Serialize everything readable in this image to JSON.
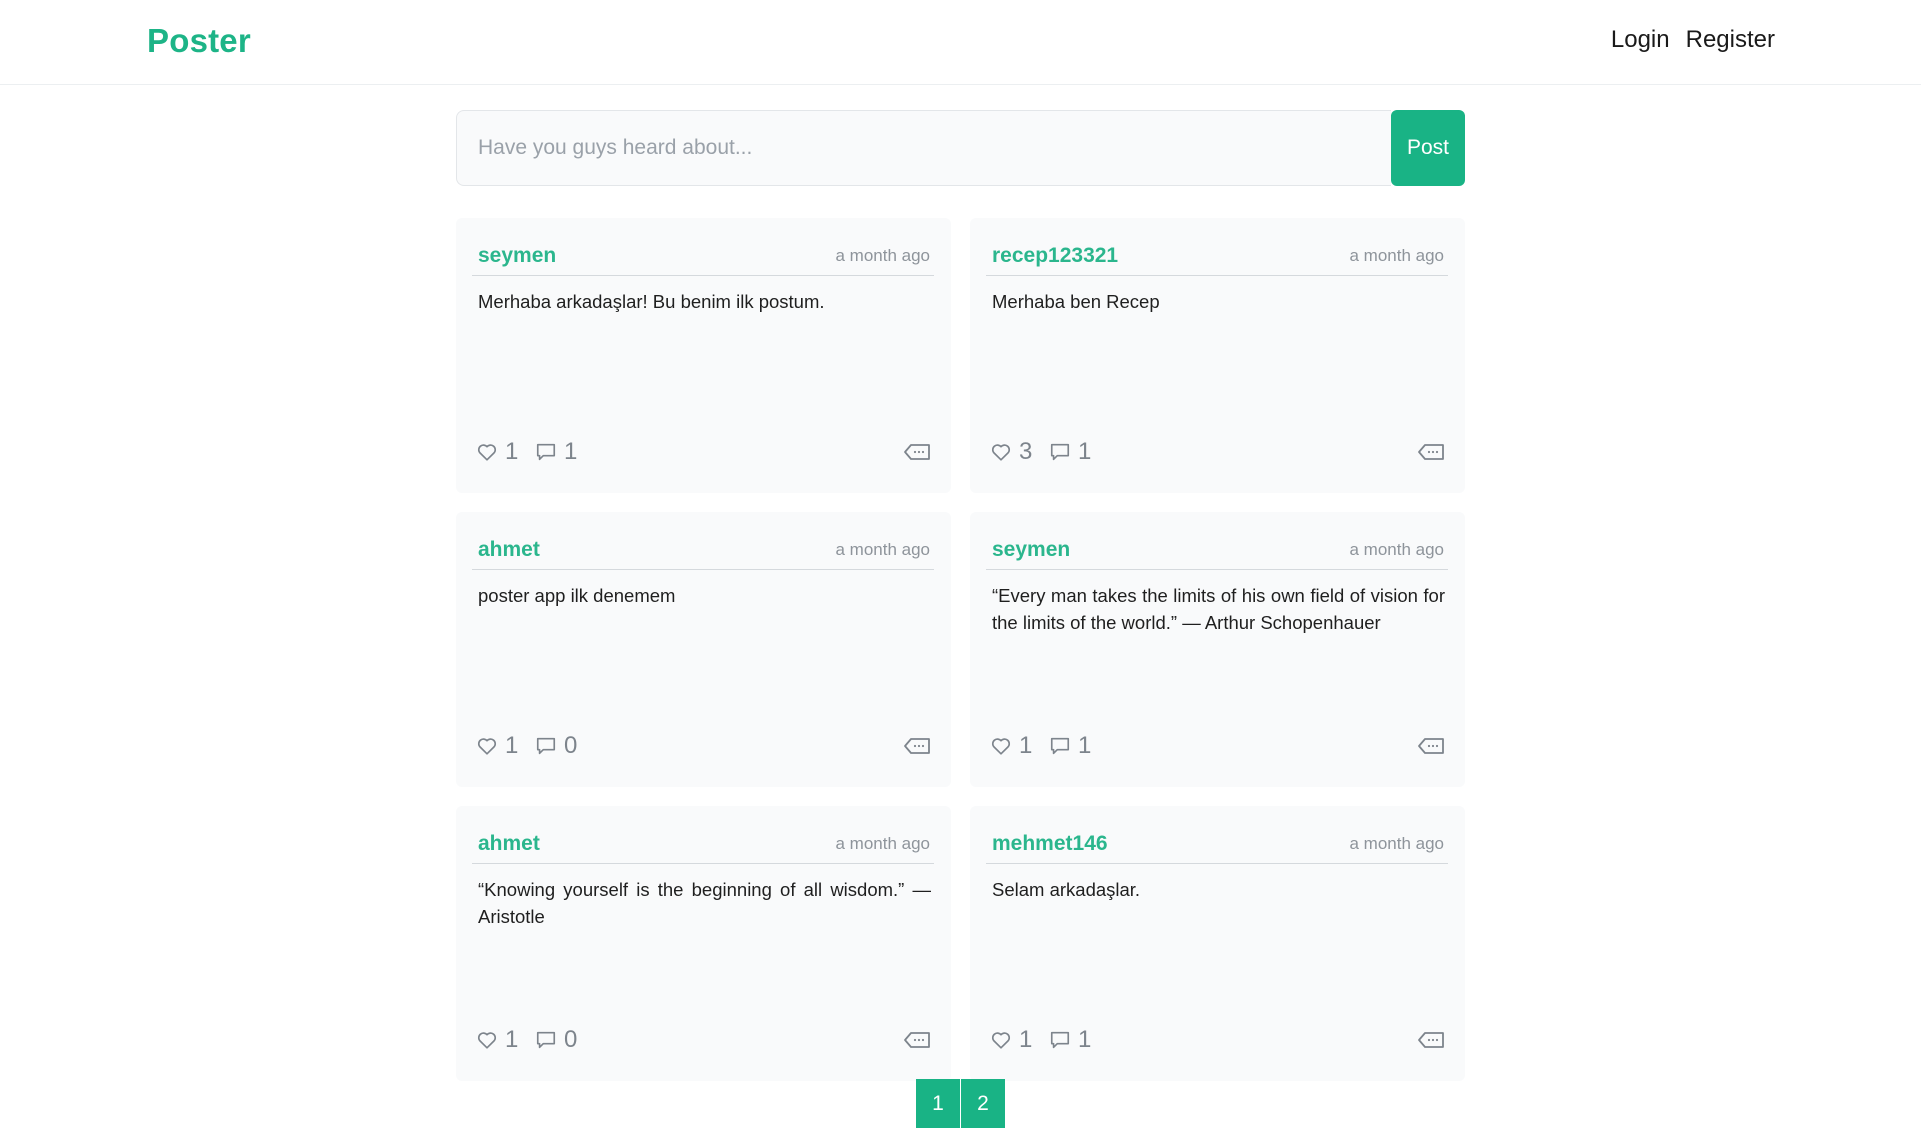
{
  "header": {
    "brand": "Poster",
    "login": "Login",
    "register": "Register"
  },
  "compose": {
    "placeholder": "Have you guys heard about...",
    "button": "Post"
  },
  "posts": [
    {
      "author": "seymen",
      "time": "a month ago",
      "body": "Merhaba arkadaşlar! Bu benim ilk postum.",
      "likes": "1",
      "comments": "1"
    },
    {
      "author": "recep123321",
      "time": "a month ago",
      "body": "Merhaba ben Recep",
      "likes": "3",
      "comments": "1"
    },
    {
      "author": "ahmet",
      "time": "a month ago",
      "body": "poster app ilk denemem",
      "likes": "1",
      "comments": "0"
    },
    {
      "author": "seymen",
      "time": "a month ago",
      "body": "“Every man takes the limits of his own field of vision for the limits of the world.” — Arthur Schopenhauer",
      "likes": "1",
      "comments": "1"
    },
    {
      "author": "ahmet",
      "time": "a month ago",
      "body": "“Knowing yourself is the beginning of all wisdom.” — Aristotle",
      "likes": "1",
      "comments": "0"
    },
    {
      "author": "mehmet146",
      "time": "a month ago",
      "body": "Selam arkadaşlar.",
      "likes": "1",
      "comments": "1"
    }
  ],
  "icons": {
    "like": "heart-icon",
    "comment": "comment-icon",
    "tag": "tag-icon"
  },
  "colors": {
    "accent": "#19b385",
    "muted": "#7d848c"
  },
  "pagination": {
    "pages": [
      "1",
      "2"
    ]
  }
}
